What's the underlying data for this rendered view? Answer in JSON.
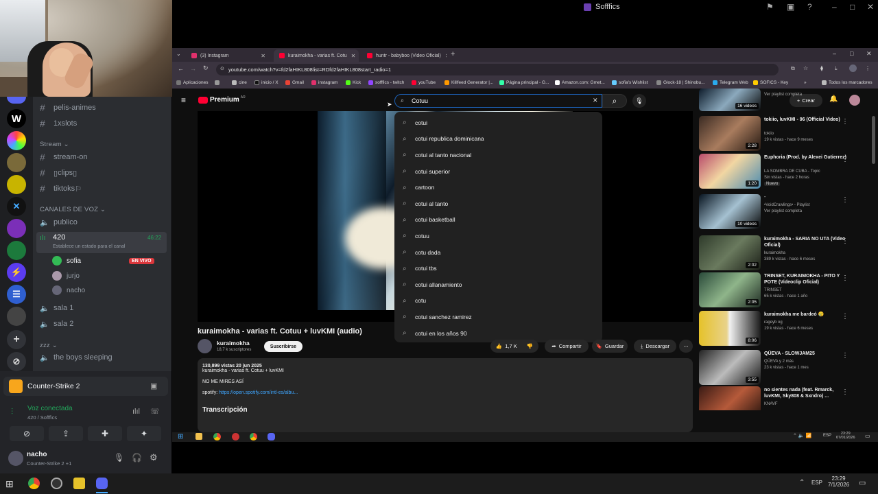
{
  "app": {
    "title": "Sofffics"
  },
  "discord": {
    "channels": [
      {
        "name": "pelis-animes"
      },
      {
        "name": "1xslots"
      }
    ],
    "stream_category": "Stream",
    "stream_channels": [
      {
        "name": "stream-on"
      },
      {
        "name": "clips"
      },
      {
        "name": "tiktoks"
      }
    ],
    "voice_category": "CANALES DE VOZ",
    "voice_channels": {
      "publico": "publico",
      "active": {
        "name": "420",
        "time": "46:22",
        "status": "Establece un estado para el canal"
      },
      "members": [
        {
          "name": "sofia",
          "badge": "EN VIVO"
        },
        {
          "name": "jurjo"
        },
        {
          "name": "nacho"
        }
      ],
      "sala1": "sala 1",
      "sala2": "sala 2"
    },
    "zzz_category": "zzz",
    "sleeping": "the boys sleeping",
    "activity": "Counter-Strike 2",
    "voice_status": "Voz conectada",
    "voice_sub": "420 / Sofffics",
    "user": {
      "name": "nacho",
      "status": "Counter-Strike 2 +1"
    }
  },
  "browser": {
    "tabs": [
      {
        "label": "(3) Instagram",
        "color": "#e1306c"
      },
      {
        "label": "kuraimokha - varias ft. Cotu",
        "color": "#ff0033"
      },
      {
        "label": "huntr - babyboo (Video Oficial)",
        "color": "#ff0033"
      }
    ],
    "url": "youtube.com/watch?v=fd2faHIKL808list=RDfd2faHIKL808start_radio=1",
    "bookmarks": [
      "Aplicaciones",
      "cine",
      "inicio / X",
      "Gmail",
      "instagram",
      "Kick",
      "sofffics - twitch",
      "youTube",
      "Killfeed Generator |...",
      "Página principal - G...",
      "Amazon.com: Gmet...",
      "sofia's Wishlist",
      "Glock-18 | Shinobu...",
      "Telegram Web",
      "SOFICS - Key",
      "Todos los marcadores"
    ],
    "bookmark_more": "»"
  },
  "youtube": {
    "logo": "Premium",
    "logo_sup": "AR",
    "search_value": "Cotuu",
    "create_label": "Crear",
    "suggestions": [
      "cotui",
      "cotui republica dominicana",
      "cotui al tanto nacional",
      "cotui superior",
      "cartoon",
      "cotui al tanto",
      "cotui basketball",
      "cotuu",
      "cotu dada",
      "cotui tbs",
      "cotui allanamiento",
      "cotu",
      "cotui sanchez ramirez",
      "cotui en los años 90"
    ],
    "video_title": "kuraimokha - varias ft. Cotuu + luvKMI (audio)",
    "channel": "kuraimokha",
    "subscribers": "18,7 k suscriptores",
    "subscribe": "Suscribirse",
    "likes": "1,7 K",
    "share": "Compartir",
    "save": "Guardar",
    "download": "Descargar",
    "desc_meta": "130,899 vistas  20 jun 2025",
    "desc_line1": "kuraimokha - varias ft. Cotuu + luvKMI",
    "desc_line2": "NO ME MIRES ASÍ",
    "desc_spotify_label": "spotify:",
    "desc_spotify": "https://open.spotify.com/intl-es/albu...",
    "transcript": "Transcripción",
    "recs": [
      {
        "title": "",
        "meta1": "Ver playlist completa",
        "meta2": "",
        "badge": "16 videos"
      },
      {
        "title": "tokiio, luvKMI - 96 (Official Video)",
        "meta1": "tokiio",
        "meta2": "19 k vistas - hace 9 meses",
        "badge": "2:28"
      },
      {
        "title": "Euphoria (Prod. by Alexei Gutierrez)",
        "meta1": "LA SOMBRA DE CUBA - Topic",
        "meta2": "Sin vistas - hace 2 horas",
        "badge": "1:20",
        "tag": "Nuevo"
      },
      {
        "title": "",
        "meta1": "•VoidCrawlings• - Playlist",
        "meta2": "Ver playlist completa",
        "badge": "10 videos"
      },
      {
        "title": "kuraimokha - SARIA NO UTA (Video Oficial)",
        "meta1": "kuraimokha",
        "meta2": "389 k vistas - hace 6 meses",
        "badge": "2:02"
      },
      {
        "title": "TRINSET, KURAIMOKHA - PITO Y POTE (Videoclip Oficial)",
        "meta1": "TRINSET",
        "meta2": "65 k vistas - hace 1 año",
        "badge": "2:05"
      },
      {
        "title": "kuraimokha me bardeó 😢",
        "meta1": "rageyb og",
        "meta2": "19 k vistas - hace 6 meses",
        "badge": "8:06"
      },
      {
        "title": "QÜEVA - SLOWJAM25",
        "meta1": "QÜEVA y 2 más",
        "meta2": "23 k vistas - hace 1 mes",
        "badge": "3:55"
      },
      {
        "title": "no sientes nada (feat. Rmarck, luvKMI, Sky808 & Sxndro) ...",
        "meta1": "KNAVF",
        "meta2": "",
        "badge": ""
      }
    ]
  },
  "taskbar": {
    "inner_time": "23:29",
    "inner_date": "07/01/2026",
    "inner_lang": "ESP",
    "time": "23:29",
    "date": "7/1/2026",
    "lang": "ESP"
  }
}
